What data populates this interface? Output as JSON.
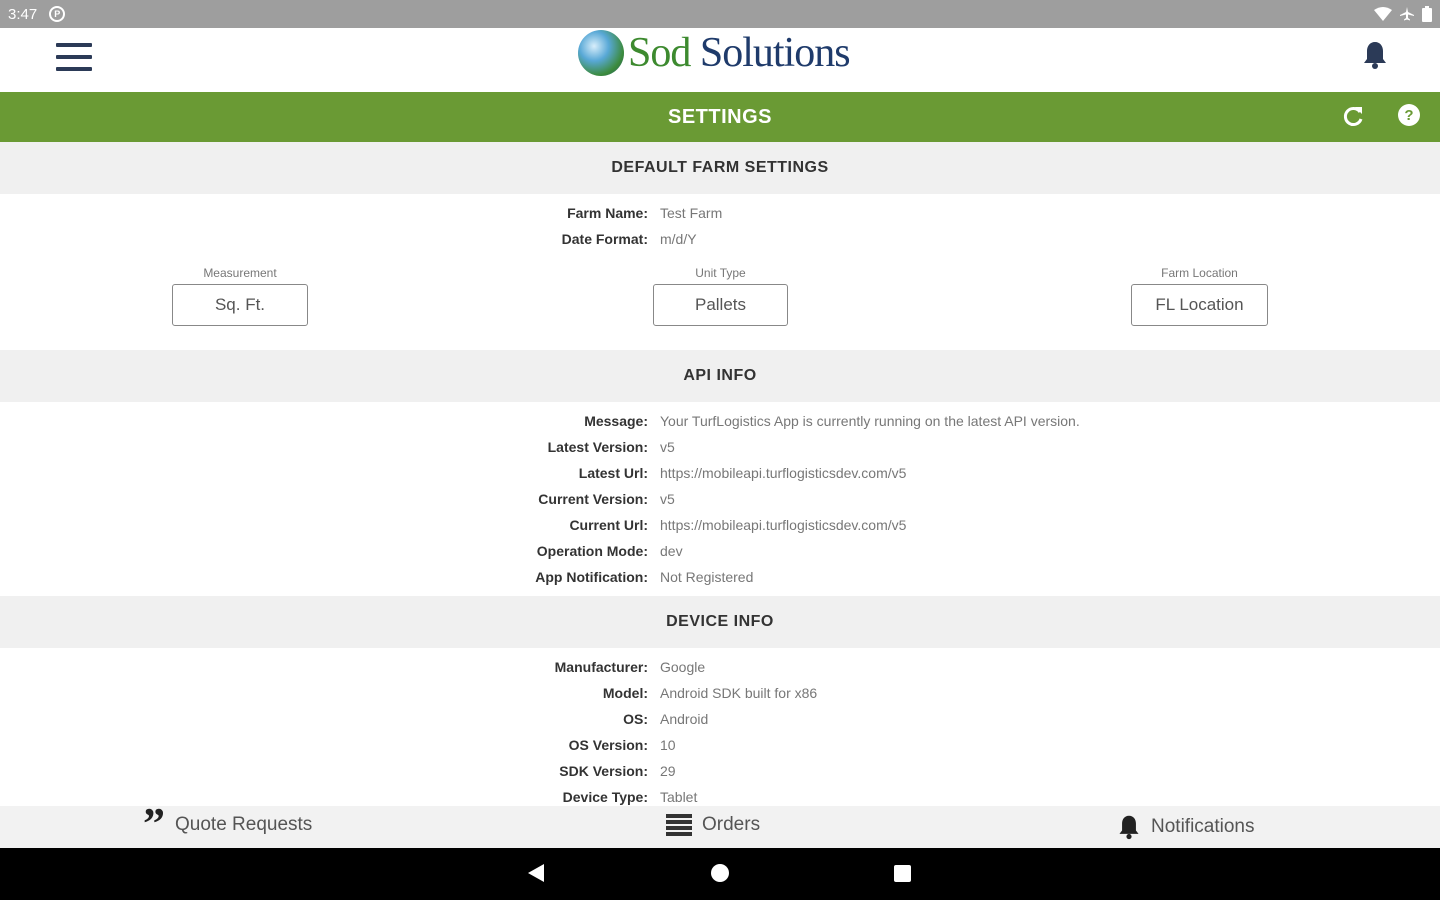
{
  "status_bar": {
    "time": "3:47",
    "badge_glyph": "⓪"
  },
  "app_bar": {
    "logo_word1": "Sod",
    "logo_word2": " Solutions",
    "menu_icon": "hamburger-icon",
    "bell_icon": "bell-icon"
  },
  "title_bar": {
    "title": "SETTINGS",
    "refresh_icon": "refresh-icon",
    "help_glyph": "?"
  },
  "farm_settings": {
    "header": "DEFAULT FARM SETTINGS",
    "rows": [
      {
        "label": "Farm Name:",
        "value": "Test Farm"
      },
      {
        "label": "Date Format:",
        "value": "m/d/Y"
      }
    ],
    "measurement": {
      "label": "Measurement",
      "value": "Sq. Ft."
    },
    "unit_type": {
      "label": "Unit Type",
      "value": "Pallets"
    },
    "farm_location": {
      "label": "Farm Location",
      "value": "FL Location"
    }
  },
  "api_info": {
    "header": "API INFO",
    "rows": [
      {
        "label": "Message:",
        "value": "Your TurfLogistics App is currently running on the latest API version."
      },
      {
        "label": "Latest Version:",
        "value": "v5"
      },
      {
        "label": "Latest Url:",
        "value": "https://mobileapi.turflogisticsdev.com/v5"
      },
      {
        "label": "Current Version:",
        "value": "v5"
      },
      {
        "label": "Current Url:",
        "value": "https://mobileapi.turflogisticsdev.com/v5"
      },
      {
        "label": "Operation Mode:",
        "value": "dev"
      },
      {
        "label": "App Notification:",
        "value": "Not Registered"
      }
    ]
  },
  "device_info": {
    "header": "DEVICE INFO",
    "rows": [
      {
        "label": "Manufacturer:",
        "value": "Google"
      },
      {
        "label": "Model:",
        "value": "Android SDK built for x86"
      },
      {
        "label": "OS:",
        "value": "Android"
      },
      {
        "label": "OS Version:",
        "value": "10"
      },
      {
        "label": "SDK Version:",
        "value": "29"
      },
      {
        "label": "Device Type:",
        "value": "Tablet"
      }
    ]
  },
  "bottom_nav": {
    "quotes": {
      "label": "Quote Requests",
      "glyph": "”"
    },
    "orders": {
      "label": "Orders"
    },
    "notifications": {
      "label": "Notifications"
    }
  },
  "colors": {
    "accent_green": "#6a9a34",
    "brand_navy": "#1f3b6b",
    "brand_green": "#3d8a2f"
  }
}
